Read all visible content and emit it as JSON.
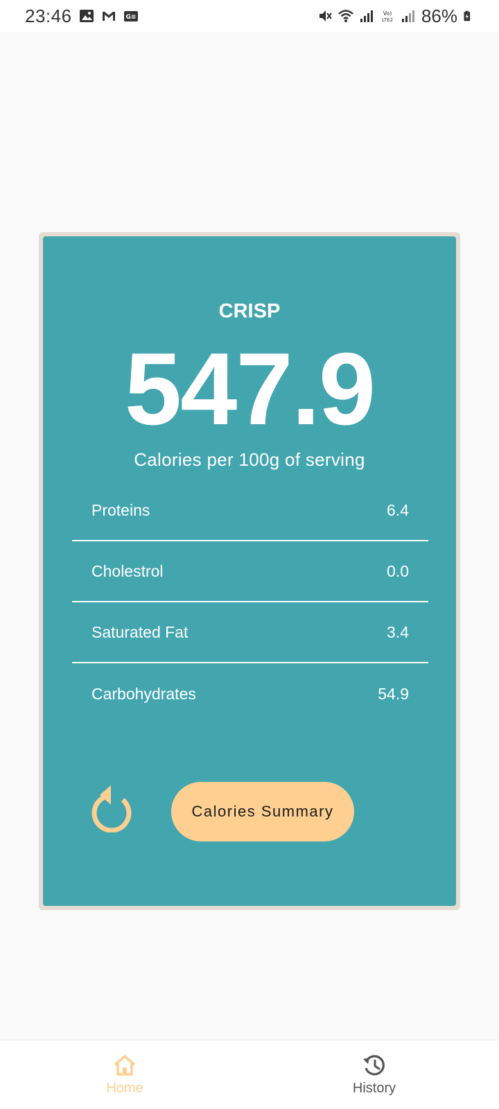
{
  "status_bar": {
    "time": "23:46",
    "battery": "86%",
    "left_icons": [
      "image-icon",
      "gmail-icon",
      "news-icon"
    ],
    "right_icons": [
      "mute-icon",
      "wifi-icon",
      "signal-icon",
      "volte-icon",
      "signal-icon",
      "battery-charging-icon"
    ]
  },
  "card": {
    "food_name": "CRISP",
    "calories": "547.9",
    "caption": "Calories per 100g of serving",
    "nutrients": [
      {
        "label": "Proteins",
        "value": "6.4"
      },
      {
        "label": "Cholestrol",
        "value": "0.0"
      },
      {
        "label": "Saturated Fat",
        "value": "3.4"
      },
      {
        "label": "Carbohydrates",
        "value": "54.9"
      }
    ],
    "summary_button": "Calories Summary"
  },
  "bottom_nav": {
    "items": [
      {
        "label": "Home",
        "icon": "home-icon",
        "active": true
      },
      {
        "label": "History",
        "icon": "history-icon",
        "active": false
      }
    ]
  },
  "colors": {
    "card_bg": "#43a5ae",
    "accent": "#fdd092",
    "card_border": "#e5dcd2",
    "page_bg": "#f9f9f9"
  }
}
